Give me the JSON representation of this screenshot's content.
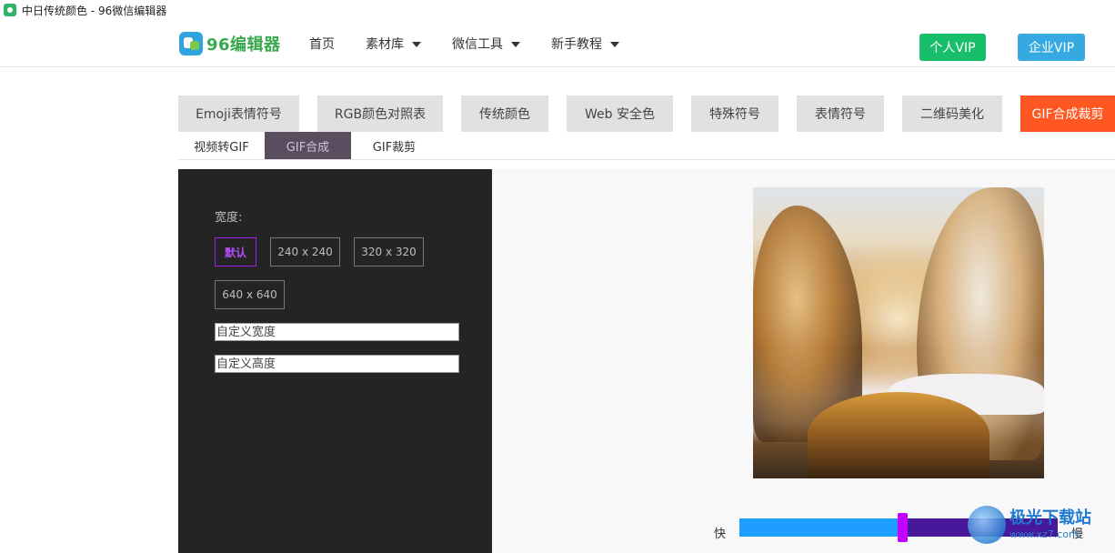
{
  "window": {
    "title": "中日传统颜色 - 96微信编辑器"
  },
  "header": {
    "logo_text": "96编辑器",
    "nav": [
      {
        "label": "首页",
        "dropdown": false
      },
      {
        "label": "素材库",
        "dropdown": true
      },
      {
        "label": "微信工具",
        "dropdown": true
      },
      {
        "label": "新手教程",
        "dropdown": true
      }
    ],
    "vip_personal": "个人VIP",
    "vip_enterprise": "企业VIP"
  },
  "tool_tabs": [
    {
      "label": "Emoji表情符号",
      "active": false
    },
    {
      "label": "RGB颜色对照表",
      "active": false
    },
    {
      "label": "传统颜色",
      "active": false
    },
    {
      "label": "Web 安全色",
      "active": false
    },
    {
      "label": "特殊符号",
      "active": false
    },
    {
      "label": "表情符号",
      "active": false
    },
    {
      "label": "二维码美化",
      "active": false
    },
    {
      "label": "GIF合成裁剪",
      "active": true
    }
  ],
  "sub_tabs": [
    {
      "label": "视频转GIF",
      "active": false
    },
    {
      "label": "GIF合成",
      "active": true
    },
    {
      "label": "GIF裁剪",
      "active": false
    }
  ],
  "settings": {
    "width_label": "宽度:",
    "sizes": [
      {
        "label": "默认",
        "selected": true
      },
      {
        "label": "240 x 240",
        "selected": false
      },
      {
        "label": "320 x 320",
        "selected": false
      },
      {
        "label": "640 x 640",
        "selected": false
      }
    ],
    "custom_width_placeholder": "自定义宽度",
    "custom_height_placeholder": "自定义高度"
  },
  "speed": {
    "fast_label": "快",
    "slow_label": "慢",
    "value": 0.51
  },
  "watermark": {
    "name": "极光下载站",
    "url": "www.xz7.com"
  },
  "colors": {
    "active_tab": "#ff5722",
    "vip_personal": "#19be6b",
    "vip_enterprise": "#36a9e1",
    "selected_size": "#a020f0",
    "speed_fill": "#1e9fff",
    "speed_track": "#48189a"
  }
}
